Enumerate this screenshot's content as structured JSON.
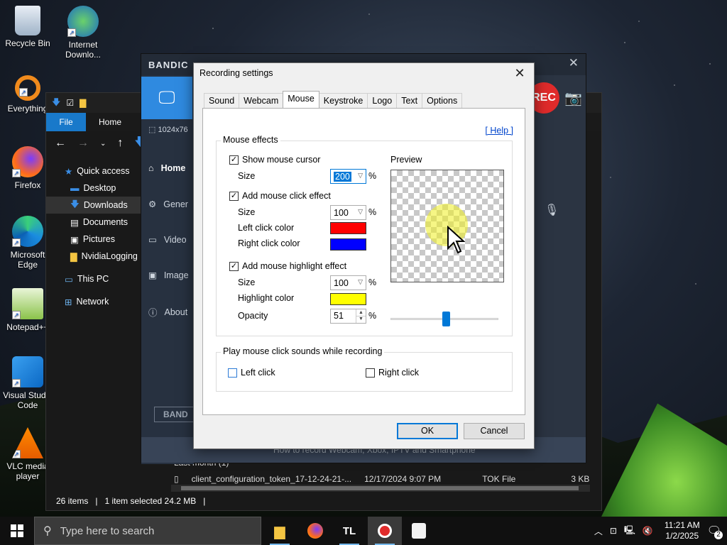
{
  "desktop": {
    "icons": [
      {
        "label": "Recycle Bin"
      },
      {
        "label": "Internet Downlo..."
      },
      {
        "label": "Everything"
      },
      {
        "label": "Firefox"
      },
      {
        "label": "Microsoft Edge"
      },
      {
        "label": "Notepad++"
      },
      {
        "label": "Visual Studio Code"
      },
      {
        "label": "VLC media player"
      }
    ]
  },
  "explorer": {
    "ribbon": {
      "file": "File",
      "home": "Home",
      "share": "S"
    },
    "sidebar": [
      {
        "label": "Quick access"
      },
      {
        "label": "Desktop"
      },
      {
        "label": "Downloads"
      },
      {
        "label": "Documents"
      },
      {
        "label": "Pictures"
      },
      {
        "label": "NvidiaLogging"
      },
      {
        "label": "This PC"
      },
      {
        "label": "Network"
      }
    ],
    "group_header": "Last month (1)",
    "file": {
      "name": "client_configuration_token_17-12-24-21-...",
      "date": "12/17/2024 9:07 PM",
      "type": "TOK File",
      "size": "3 KB"
    },
    "status": {
      "count": "26 items",
      "selection": "1 item selected  24.2 MB"
    }
  },
  "bandicam": {
    "logo": "BANDIC",
    "resolution": "1024x76",
    "nav": [
      {
        "label": "Home"
      },
      {
        "label": "Gener"
      },
      {
        "label": "Video"
      },
      {
        "label": "Image"
      },
      {
        "label": "About"
      }
    ],
    "rec": "REC",
    "footer_logo": "BAND",
    "footer_text": "How to record Webcam, Xbox, IPTV and Smartphone"
  },
  "dialog": {
    "title": "Recording settings",
    "tabs": [
      {
        "label": "Sound"
      },
      {
        "label": "Webcam"
      },
      {
        "label": "Mouse"
      },
      {
        "label": "Keystroke"
      },
      {
        "label": "Logo"
      },
      {
        "label": "Text"
      },
      {
        "label": "Options"
      }
    ],
    "help": "[ Help ]",
    "mouse_effects": {
      "title": "Mouse effects",
      "show_cursor": {
        "label": "Show mouse cursor",
        "checked": true,
        "size_label": "Size",
        "size": "200"
      },
      "click_effect": {
        "label": "Add mouse click effect",
        "checked": true,
        "size_label": "Size",
        "size": "100",
        "left_label": "Left click color",
        "left_color": "#ff0000",
        "right_label": "Right click color",
        "right_color": "#0000ff"
      },
      "highlight": {
        "label": "Add mouse highlight effect",
        "checked": true,
        "size_label": "Size",
        "size": "100",
        "color_label": "Highlight color",
        "color": "#ffff00",
        "opacity_label": "Opacity",
        "opacity": "51"
      },
      "percent": "%"
    },
    "preview_label": "Preview",
    "sounds": {
      "title": "Play mouse click sounds while recording",
      "left": {
        "label": "Left click",
        "checked": false
      },
      "right": {
        "label": "Right click",
        "checked": false
      }
    },
    "ok": "OK",
    "cancel": "Cancel"
  },
  "taskbar": {
    "search_placeholder": "Type here to search",
    "time": "11:21 AM",
    "date": "1/2/2025",
    "notifications": "2",
    "tl": "TL"
  }
}
